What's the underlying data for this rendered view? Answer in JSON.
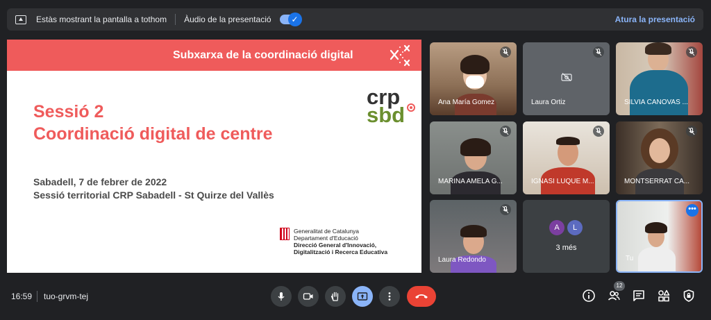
{
  "topbar": {
    "sharing_text": "Estàs mostrant la pantalla a tothom",
    "audio_label": "Àudio de la presentació",
    "toggle_check": "✓",
    "stop_label": "Atura la presentació"
  },
  "slide": {
    "header": "Subxarxa de la coordinació digital",
    "title_line1": "Sessió 2",
    "title_line2": "Coordinació digital de centre",
    "logo_crp": "crp",
    "logo_sbd": "sbd",
    "date_line": "Sabadell, 7 de febrer de 2022",
    "session_line": "Sessió territorial CRP Sabadell - St Quirze del Vallès",
    "gencat": {
      "line1": "Generalitat de Catalunya",
      "line2": "Departament d'Educació",
      "line3": "Direcció General d'Innovació,",
      "line4": "Digitalització i Recerca Educativa"
    }
  },
  "participants": [
    {
      "name": "Ana María Gomez"
    },
    {
      "name": "Laura Ortiz"
    },
    {
      "name": "SILVIA CANOVAS ..."
    },
    {
      "name": "MARINA AMELA G..."
    },
    {
      "name": "IGNASI LUQUE M..."
    },
    {
      "name": "MONTSERRAT CA..."
    },
    {
      "name": "Laura Redondo"
    },
    {
      "name": "Tu"
    }
  ],
  "overflow": {
    "avatar1": "A",
    "avatar2": "L",
    "avatar1_color": "#7b3fa0",
    "avatar2_color": "#5c6bc0",
    "label": "3 més"
  },
  "bottombar": {
    "time": "16:59",
    "meeting_code": "tuo-grvm-tej",
    "people_count": "12"
  },
  "colors": {
    "accent": "#8ab4f8",
    "slide_red": "#ef5b5b",
    "end_call": "#ea4335"
  }
}
